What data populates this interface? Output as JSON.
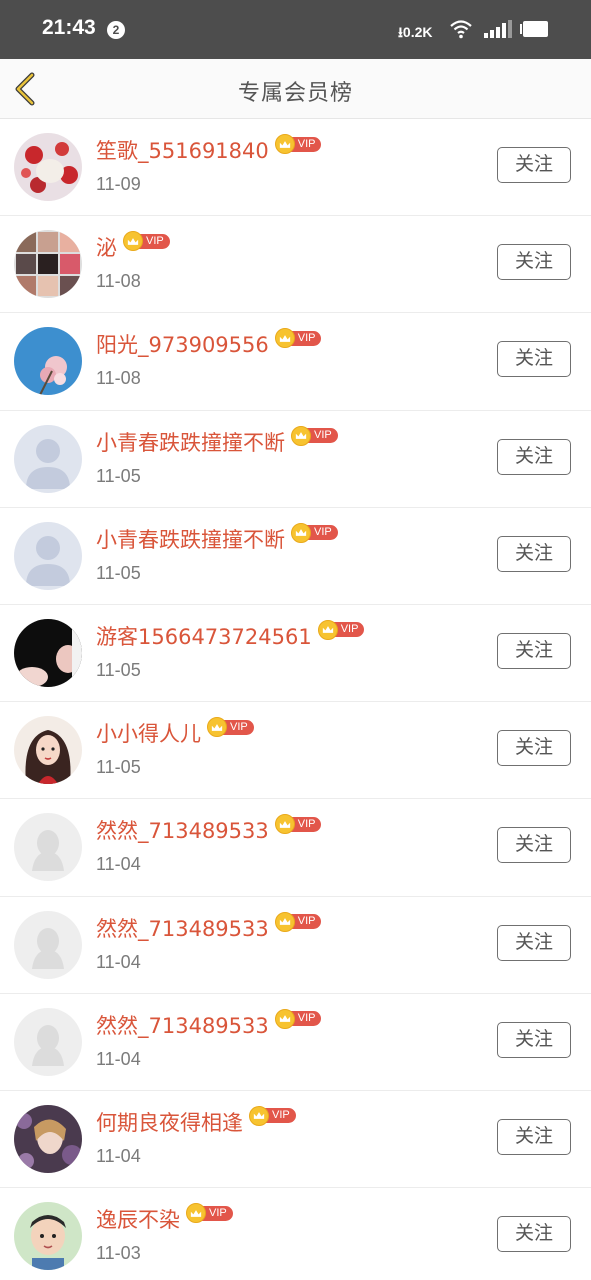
{
  "status_bar": {
    "time": "21:43",
    "notification_count": "2",
    "net_speed": "0.2K",
    "icons": [
      "download-arrow-icon",
      "wifi-icon",
      "signal-icon",
      "battery-icon"
    ]
  },
  "header": {
    "title": "专属会员榜",
    "back_icon": "chevron-left-icon",
    "back_icon_color": "#c9a227"
  },
  "vip_label": "VIP",
  "follow_label": "关注",
  "colors": {
    "name": "#d9553a",
    "vip_tag": "#e2564a",
    "vip_crown": "#f7c330"
  },
  "members": [
    {
      "name": "笙歌_551691840",
      "date": "11-09",
      "avatar": "photo-red-flowers"
    },
    {
      "name": "泌",
      "date": "11-08",
      "avatar": "photo-grid-collage"
    },
    {
      "name": "阳光_973909556",
      "date": "11-08",
      "avatar": "photo-blue-sky-flower"
    },
    {
      "name": "小青春跌跌撞撞不断",
      "date": "11-05",
      "avatar": "default-person"
    },
    {
      "name": "小青春跌跌撞撞不断",
      "date": "11-05",
      "avatar": "default-person"
    },
    {
      "name": "游客1566473724561",
      "date": "11-05",
      "avatar": "photo-dark-hands"
    },
    {
      "name": "小小得人儿",
      "date": "11-05",
      "avatar": "illustration-girl"
    },
    {
      "name": "然然_713489533",
      "date": "11-04",
      "avatar": "default-penguin"
    },
    {
      "name": "然然_713489533",
      "date": "11-04",
      "avatar": "default-penguin"
    },
    {
      "name": "然然_713489533",
      "date": "11-04",
      "avatar": "default-penguin"
    },
    {
      "name": "何期良夜得相逢",
      "date": "11-04",
      "avatar": "photo-woman-flowers"
    },
    {
      "name": "逸辰不染",
      "date": "11-03",
      "avatar": "photo-child"
    }
  ]
}
